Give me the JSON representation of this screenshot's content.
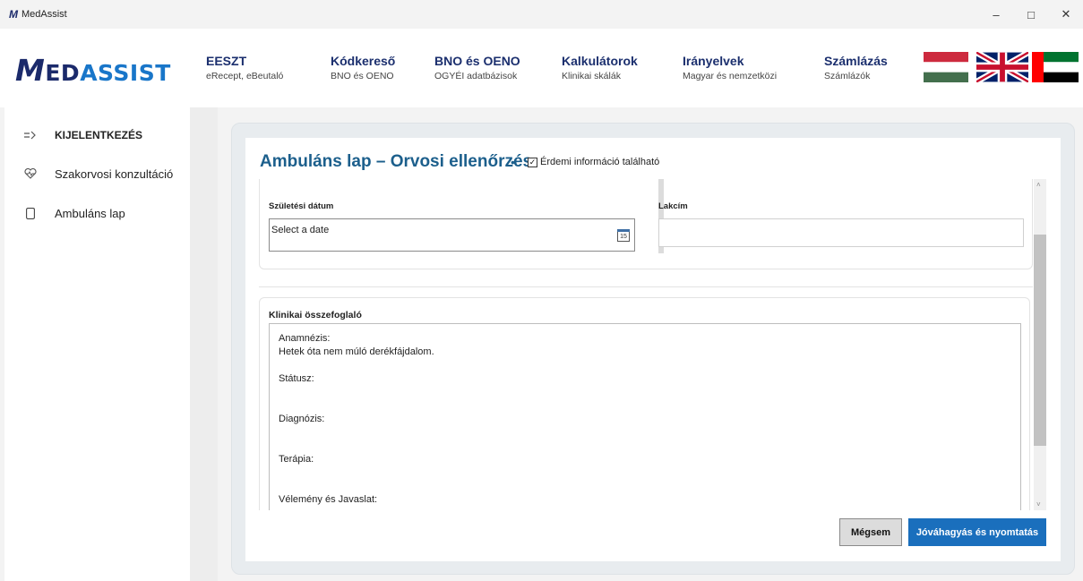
{
  "window": {
    "title": "MedAssist",
    "logo_glyph": "M",
    "controls": {
      "minimize": "–",
      "maximize": "□",
      "close": "✕"
    }
  },
  "header": {
    "logo": {
      "m": "M",
      "ed": "ED",
      "assist": "ASSIST"
    },
    "nav": [
      {
        "title": "EESZT",
        "subtitle": "eRecept, eBeutaló"
      },
      {
        "title": "Kódkereső",
        "subtitle": "BNO és OENO"
      },
      {
        "title": "BNO és OENO",
        "subtitle": "OGYÉI adatbázisok"
      },
      {
        "title": "Kalkulátorok",
        "subtitle": "Klinikai skálák"
      },
      {
        "title": "Irányelvek",
        "subtitle": "Magyar és nemzetközi"
      },
      {
        "title": "Számlázás",
        "subtitle": "Számlázók"
      }
    ],
    "flags": [
      "hungary-flag",
      "uk-flag",
      "uae-flag"
    ],
    "colors": {
      "brand_dark": "#1b2a6b",
      "brand_light": "#1976c9"
    }
  },
  "sidebar": {
    "items": [
      {
        "label": "KIJELENTKEZÉS",
        "icon": "logout-icon"
      },
      {
        "label": "Szakorvosi konzultáció",
        "icon": "heart-pulse-icon"
      },
      {
        "label": "Ambuláns lap",
        "icon": "document-icon"
      }
    ]
  },
  "form": {
    "title": "Ambuláns lap – Orvosi ellenőrzés",
    "dot": "•",
    "checkbox_checked": true,
    "checkbox_mark": "✓",
    "checkbox_label": "Érdemi információ található",
    "birth_date_label": "Születési dátum",
    "birth_date_placeholder": "Select a date",
    "calendar_day": "15",
    "address_label": "Lakcím",
    "address_value": "",
    "summary_title": "Klinikai összefoglaló",
    "summary_lines": [
      "Anamnézis:",
      "Hetek óta nem múló derékfájdalom.",
      "Státusz:",
      "Diagnózis:",
      "Terápia:",
      "Vélemény és Javaslat:"
    ]
  },
  "buttons": {
    "cancel": "Mégsem",
    "approve": "Jóváhagyás és nyomtatás"
  },
  "scrollbar": {
    "up": "˄",
    "down": "˅"
  },
  "accent_color": "#1a6fbd"
}
